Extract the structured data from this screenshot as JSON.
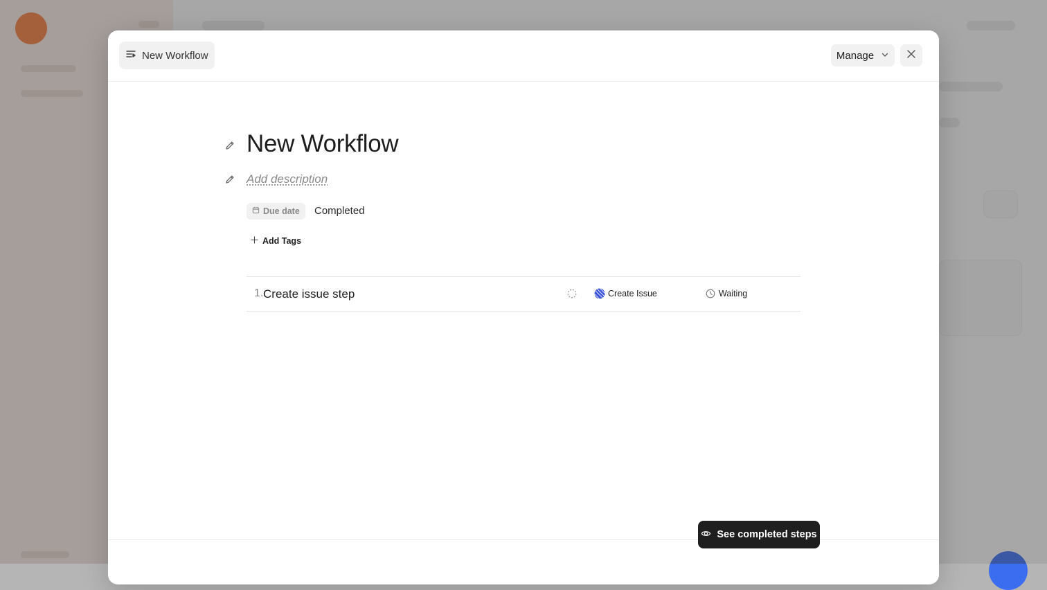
{
  "header": {
    "breadcrumb_label": "New Workflow",
    "manage_label": "Manage"
  },
  "workflow": {
    "title": "New Workflow",
    "description_placeholder": "Add description",
    "due_date_label": "Due date",
    "status": "Completed",
    "add_tags_label": "Add Tags"
  },
  "steps": [
    {
      "number": "1.",
      "name": "Create issue step",
      "action": "Create Issue",
      "state": "Waiting"
    }
  ],
  "footer": {
    "see_completed_label": "See completed steps"
  },
  "colors": {
    "accent_dark": "#1f1f1f",
    "background_brand": "#f07a3c",
    "action_icon_blue": "#3a52d8"
  }
}
